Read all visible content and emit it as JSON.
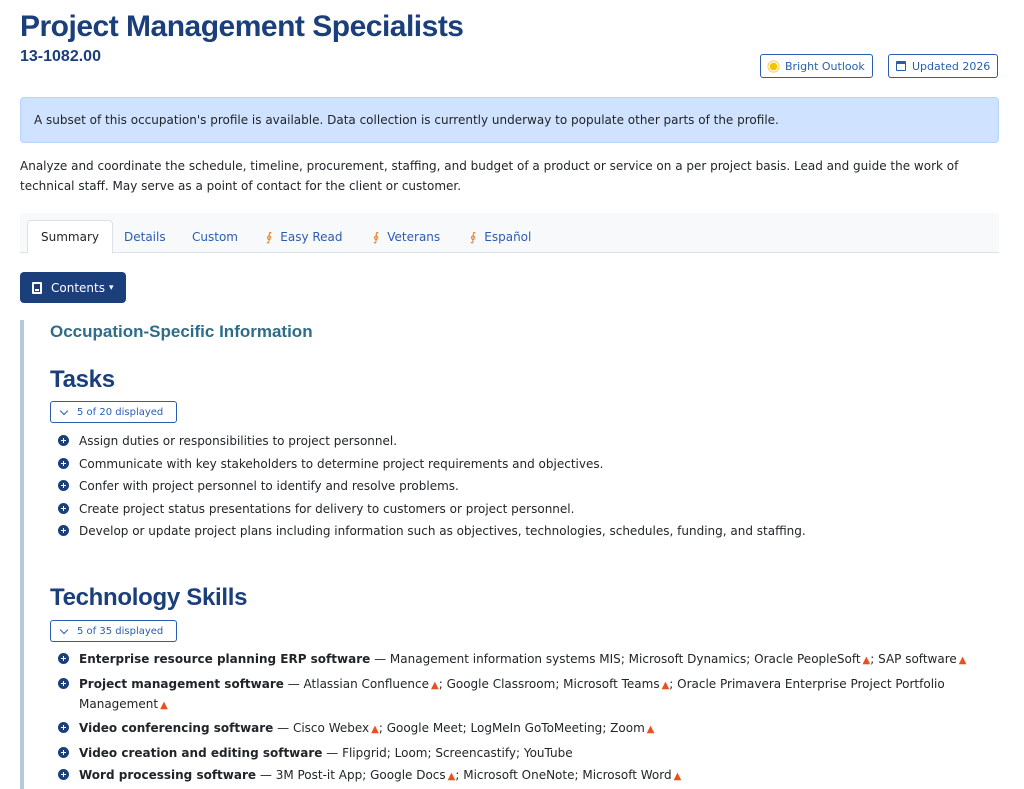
{
  "header": {
    "title": "Project Management Specialists",
    "code": "13-1082.00",
    "badges": {
      "outlook": "Bright Outlook",
      "updated": "Updated 2026"
    }
  },
  "alert": "A subset of this occupation's profile is available. Data collection is currently underway to populate other parts of the profile.",
  "description": "Analyze and coordinate the schedule, timeline, procurement, staffing, and budget of a product or service on a per project basis. Lead and guide the work of technical staff. May serve as a point of contact for the client or customer.",
  "tabs": [
    "Summary",
    "Details",
    "Custom",
    "Easy Read",
    "Veterans",
    "Español"
  ],
  "contents_button": "Contents",
  "section_heading": "Occupation-Specific Information",
  "tasks": {
    "heading": "Tasks",
    "toggle": "5 of 20 displayed",
    "items": [
      "Assign duties or responsibilities to project personnel.",
      "Communicate with key stakeholders to determine project requirements and objectives.",
      "Confer with project personnel to identify and resolve problems.",
      "Create project status presentations for delivery to customers or project personnel.",
      "Develop or update project plans including information such as objectives, technologies, schedules, funding, and staffing."
    ]
  },
  "tech": {
    "heading": "Technology Skills",
    "toggle": "5 of 35 displayed",
    "items": [
      {
        "category": "Enterprise resource planning ERP software",
        "sep": " — ",
        "examples": [
          {
            "name": "Management information systems MIS",
            "hot": false
          },
          {
            "name": "Microsoft Dynamics",
            "hot": false
          },
          {
            "name": "Oracle PeopleSoft",
            "hot": true
          },
          {
            "name": "SAP software",
            "hot": true
          }
        ]
      },
      {
        "category": "Project management software",
        "sep": " — ",
        "examples": [
          {
            "name": "Atlassian Confluence",
            "hot": true
          },
          {
            "name": "Google Classroom",
            "hot": false
          },
          {
            "name": "Microsoft Teams",
            "hot": true
          },
          {
            "name": "Oracle Primavera Enterprise Project Portfolio Management",
            "hot": true
          }
        ]
      },
      {
        "category": "Video conferencing software",
        "sep": " — ",
        "examples": [
          {
            "name": "Cisco Webex",
            "hot": true
          },
          {
            "name": "Google Meet",
            "hot": false
          },
          {
            "name": "LogMeIn GoToMeeting",
            "hot": false
          },
          {
            "name": "Zoom",
            "hot": true
          }
        ]
      },
      {
        "category": "Video creation and editing software",
        "sep": " — ",
        "examples": [
          {
            "name": "Flipgrid",
            "hot": false
          },
          {
            "name": "Loom",
            "hot": false
          },
          {
            "name": "Screencastify",
            "hot": false
          },
          {
            "name": "YouTube",
            "hot": false
          }
        ]
      },
      {
        "category": "Word processing software",
        "sep": " — ",
        "examples": [
          {
            "name": "3M Post-it App",
            "hot": false
          },
          {
            "name": "Google Docs",
            "hot": true
          },
          {
            "name": "Microsoft OneNote",
            "hot": false
          },
          {
            "name": "Microsoft Word",
            "hot": true
          }
        ]
      }
    ]
  },
  "icons": {
    "hot": "hot-technology-icon",
    "plus": "plus-circle-icon",
    "sun": "sun-icon",
    "calendar": "calendar-icon",
    "handshake": "handshake-icon",
    "book": "book-icon"
  },
  "colors": {
    "brand": "#1a3f7a",
    "link": "#2a5db0",
    "alert_bg": "#cfe2ff",
    "hot": "#e8501c",
    "bright_outlook": "#f5c400"
  }
}
